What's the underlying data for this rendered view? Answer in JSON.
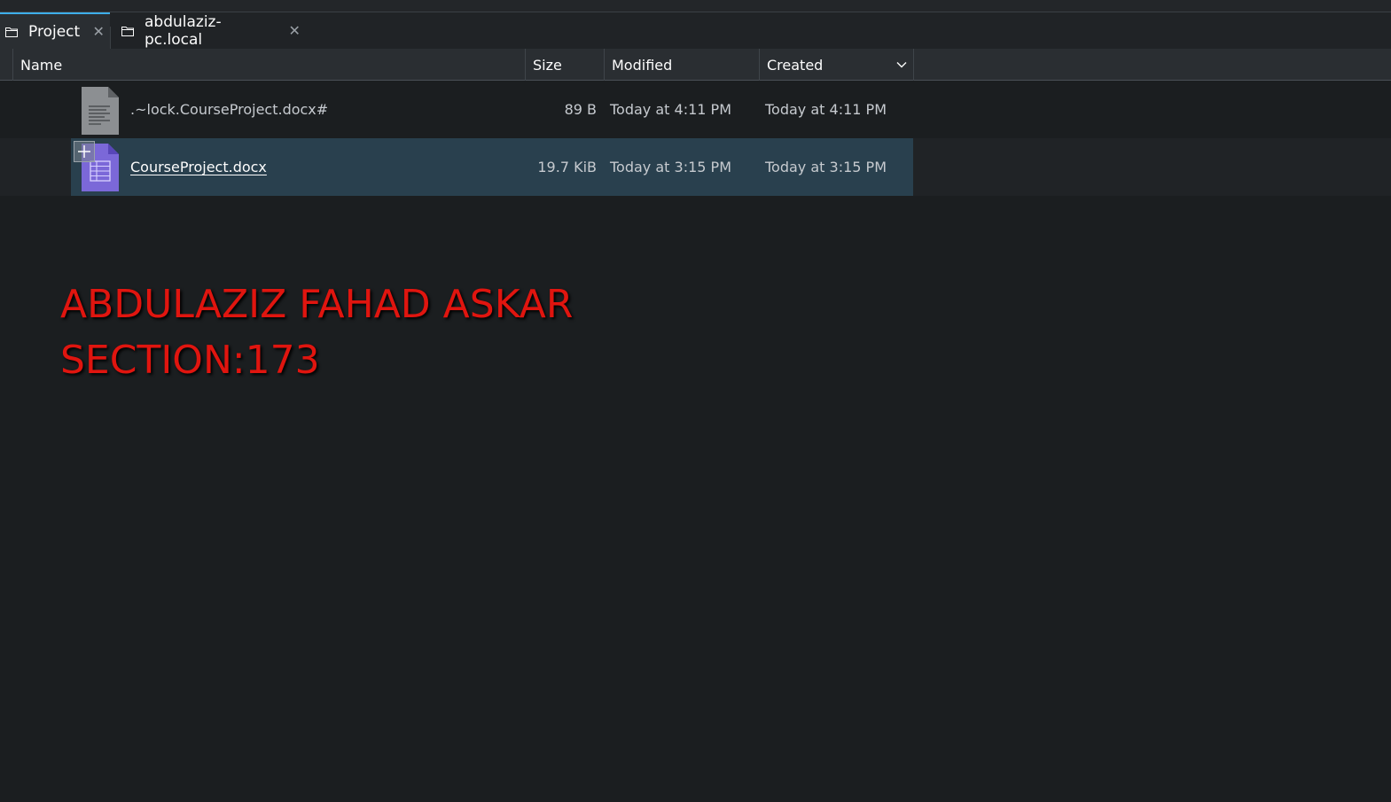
{
  "tabs": [
    {
      "label": "Project",
      "icon": "folder-icon",
      "active": true
    },
    {
      "label": "abdulaziz-pc.local",
      "icon": "folder-icon",
      "active": false
    }
  ],
  "close_glyph": "✕",
  "columns": {
    "name": "Name",
    "size": "Size",
    "modified": "Modified",
    "created": "Created"
  },
  "files": [
    {
      "name": ".~lock.CourseProject.docx#",
      "size": "89 B",
      "modified": "Today at 4:11 PM",
      "created": "Today at 4:11 PM",
      "icon": "text-file-icon",
      "selected": false
    },
    {
      "name": "CourseProject.docx",
      "size": "19.7 KiB",
      "modified": "Today at 3:15 PM",
      "created": "Today at 3:15 PM",
      "icon": "document-file-icon",
      "selected": true
    }
  ],
  "overlay": {
    "line1": "ABDULAZIZ FAHAD ASKAR",
    "line2": "SECTION:173"
  },
  "colors": {
    "accent": "#3daee9",
    "selection": "#29404e",
    "overlay_text": "#e0150f"
  }
}
